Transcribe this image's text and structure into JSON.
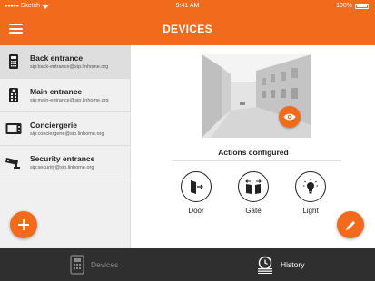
{
  "status_bar": {
    "carrier": "Sketch",
    "time": "9:41 AM",
    "battery": "100%"
  },
  "header": {
    "title": "DEVICES"
  },
  "devices": [
    {
      "name": "Back entrance",
      "address": "sip:back-entrance@sip.linhome.org",
      "icon": "intercom-keypad-icon"
    },
    {
      "name": "Main entrance",
      "address": "sip:main-entrance@sip.linhome.org",
      "icon": "intercom-panel-icon"
    },
    {
      "name": "Conciergerie",
      "address": "sip:conciergerie@sip.linhome.org",
      "icon": "indoor-monitor-icon"
    },
    {
      "name": "Security entrance",
      "address": "sip:security@sip.linhome.org",
      "icon": "security-camera-icon"
    }
  ],
  "detail": {
    "actions_title": "Actions configured",
    "actions": [
      {
        "label": "Door",
        "icon": "door-icon"
      },
      {
        "label": "Gate",
        "icon": "gate-icon"
      },
      {
        "label": "Light",
        "icon": "light-bulb-icon"
      }
    ]
  },
  "bottom_nav": {
    "devices_label": "Devices",
    "history_label": "History",
    "active": "History"
  },
  "colors": {
    "accent": "#f26b1d",
    "bottom_bar": "#2f2f2f",
    "sidebar": "#f0f0f0"
  }
}
